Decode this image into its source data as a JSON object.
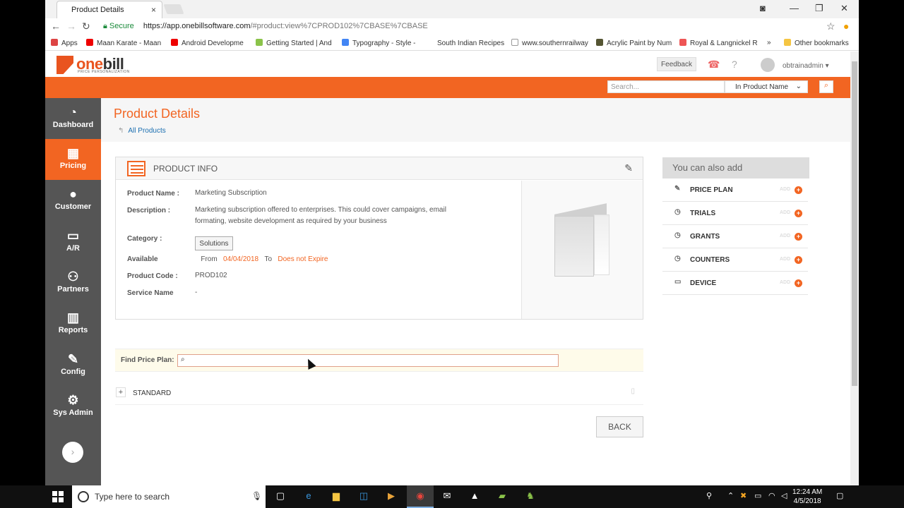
{
  "browser": {
    "tab_title": "Product Details",
    "tab_close": "×",
    "url_secure_label": "Secure",
    "url_host": "https://app.onebillsoftware.com",
    "url_path": "/#product:view%7CPROD102%7CBASE%7CBASE",
    "bookmarks": [
      "Apps",
      "Maan Karate - Maan",
      "Android Developme",
      "Getting Started | And",
      "Typography - Style -",
      "South Indian Recipes",
      "www.southernrailway",
      "Acrylic Paint by Num",
      "Royal & Langnickel R",
      "»",
      "Other bookmarks"
    ]
  },
  "header": {
    "logo_one": "one",
    "logo_bill": "bill",
    "logo_tagline": "PRICE PERSONALIZATION",
    "feedback": "Feedback",
    "user": "obtrainadmin"
  },
  "search": {
    "placeholder": "Search...",
    "scope": "In Product Name"
  },
  "sidebar": {
    "items": [
      {
        "label": "Dashboard",
        "icon": "gauge-icon"
      },
      {
        "label": "Pricing",
        "icon": "grid-icon"
      },
      {
        "label": "Customer",
        "icon": "user-icon"
      },
      {
        "label": "A/R",
        "icon": "card-icon"
      },
      {
        "label": "Partners",
        "icon": "users-icon"
      },
      {
        "label": "Reports",
        "icon": "chart-icon"
      },
      {
        "label": "Config",
        "icon": "wrench-icon"
      },
      {
        "label": "Sys Admin",
        "icon": "gear-icon"
      }
    ]
  },
  "page": {
    "title": "Product Details",
    "back_link": "All Products"
  },
  "product": {
    "section_title": "PRODUCT INFO",
    "name_label": "Product Name",
    "name_value": "Marketing Subscription",
    "desc_label": "Description",
    "desc_value_1": "Marketing subscription offered to enterprises. This could cover campaigns, email",
    "desc_value_2": "formating, website development as required by your business",
    "category_label": "Category",
    "category_value": "Solutions",
    "available_label": "Available",
    "available_from": "From",
    "available_start": "04/04/2018",
    "available_to": "To",
    "available_end": "Does not Expire",
    "code_label": "Product Code",
    "code_value": "PROD102",
    "service_label": "Service Name",
    "service_value": "-"
  },
  "add_panel": {
    "title": "You can also add",
    "items": [
      "PRICE PLAN",
      "TRIALS",
      "GRANTS",
      "COUNTERS",
      "DEVICE"
    ],
    "add_label": "ADD"
  },
  "price_plans": {
    "find_label": "Find Price Plan:",
    "find_value": "",
    "plans": [
      "STANDARD"
    ],
    "back_button": "BACK"
  },
  "taskbar": {
    "search_placeholder": "Type here to search",
    "time": "12:24 AM",
    "date": "4/5/2018"
  },
  "colors": {
    "brand_orange": "#f26522",
    "sidebar_gray": "#555555"
  }
}
